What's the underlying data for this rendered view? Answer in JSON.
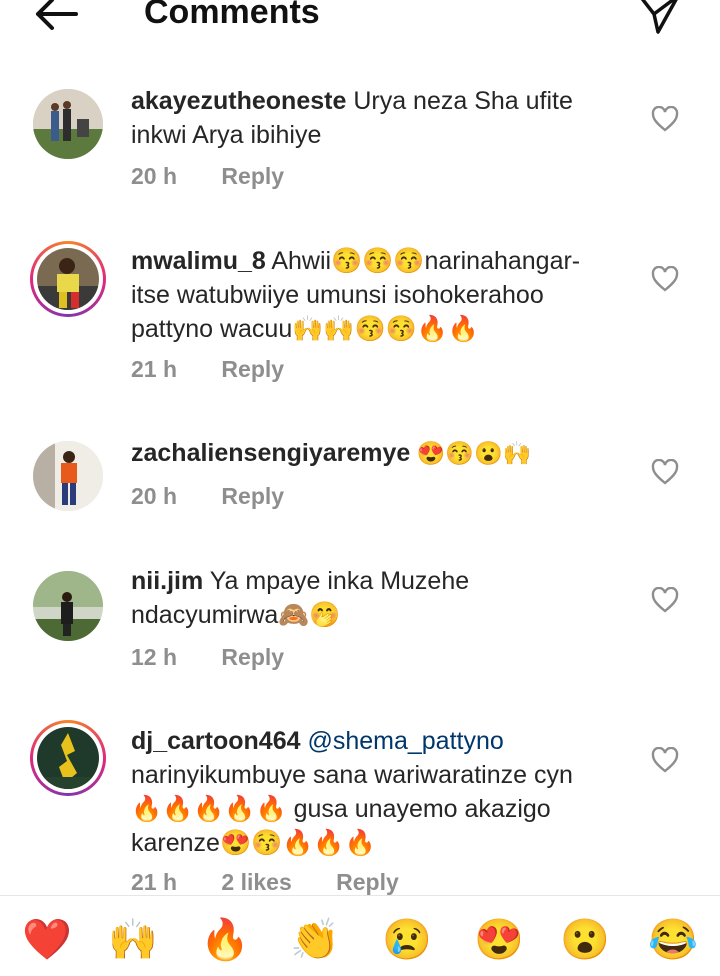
{
  "header": {
    "title": "Comments",
    "back_icon": "back-arrow-icon",
    "send_icon": "send-icon"
  },
  "comments": [
    {
      "username": "akayezutheoneste",
      "text_line1": " Urya neza Sha ufite",
      "text_line2": "inkwi Arya ibihiye",
      "time": "20 h",
      "reply": "Reply"
    },
    {
      "username": "mwalimu_8",
      "text_line1": " Ahwii😚😚😚narinahangar-",
      "text_line2": "itse watubwiiye umunsi isohokerahoo",
      "text_line3": "pattyno wacuu🙌🙌😚😚🔥🔥",
      "time": "21 h",
      "reply": "Reply"
    },
    {
      "username": "zachaliensengiyaremye",
      "text_line1": " 😍😚😮🙌",
      "time": "20 h",
      "reply": "Reply"
    },
    {
      "username": "nii.jim",
      "text_line1": " Ya mpaye inka Muzehe",
      "text_line2": "ndacyumirwa🙈🤭",
      "time": "12 h",
      "reply": "Reply"
    },
    {
      "username": "dj_cartoon464",
      "mention": " @shema_pattyno",
      "text_line2": "narinyikumbuye sana wariwaratinze cyn",
      "text_line3": "🔥🔥🔥🔥🔥 gusa unayemo akazigo",
      "text_line4": "karenze😍😚🔥🔥🔥",
      "time": "21 h",
      "likes": "2 likes",
      "reply": "Reply"
    }
  ],
  "emoji_bar": [
    "❤️",
    "🙌",
    "🔥",
    "👏",
    "😢",
    "😍",
    "😮",
    "😂"
  ]
}
